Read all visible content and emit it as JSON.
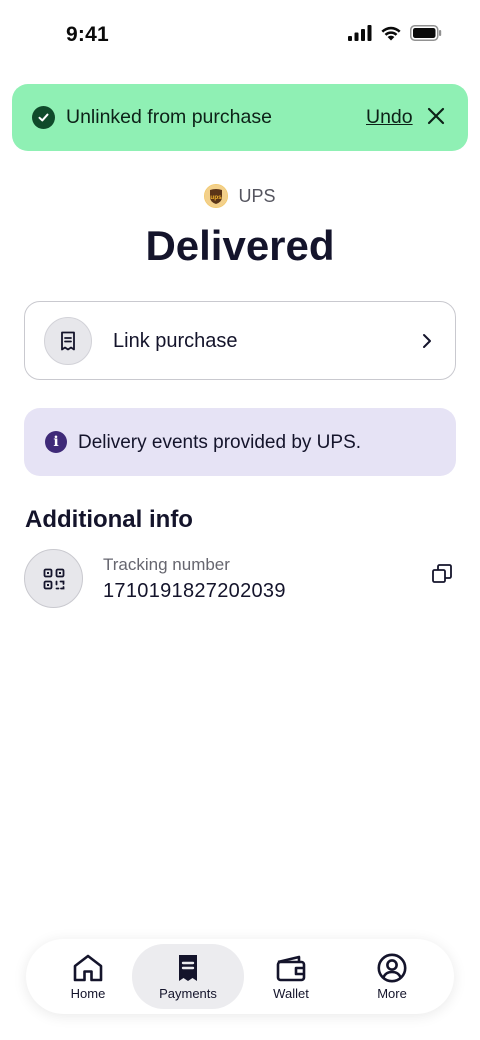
{
  "status_bar": {
    "time": "9:41"
  },
  "toast": {
    "message": "Unlinked from purchase",
    "undo_label": "Undo"
  },
  "carrier": {
    "name": "UPS",
    "logo_text": "ups"
  },
  "delivery_status": "Delivered",
  "link_purchase": {
    "label": "Link purchase"
  },
  "info_banner": {
    "text": "Delivery events provided by UPS."
  },
  "additional_info": {
    "title": "Additional info",
    "tracking_label": "Tracking number",
    "tracking_number": "1710191827202039"
  },
  "tabs": [
    {
      "label": "Home",
      "icon": "home-icon",
      "active": false
    },
    {
      "label": "Payments",
      "icon": "payments-icon",
      "active": true
    },
    {
      "label": "Wallet",
      "icon": "wallet-icon",
      "active": false
    },
    {
      "label": "More",
      "icon": "profile-icon",
      "active": false
    }
  ],
  "colors": {
    "toast_bg": "#8ff0b4",
    "info_bg": "#e6e3f5",
    "info_icon": "#3f2a78",
    "text_primary": "#14142b"
  }
}
